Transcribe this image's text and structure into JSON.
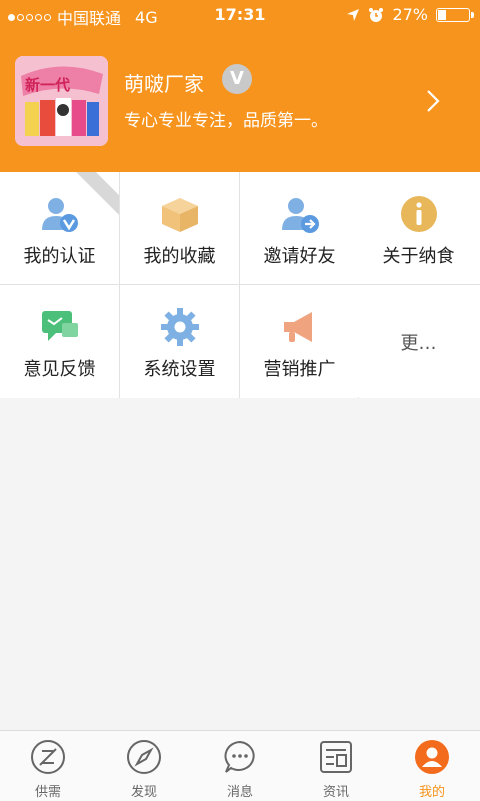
{
  "status_bar": {
    "carrier": "中国联通",
    "network": "4G",
    "time": "17:31",
    "battery": "27%",
    "battery_level": 0.27
  },
  "profile": {
    "name": "萌啵厂家",
    "verified_badge": "V",
    "slogan": "专心专业专注，品质第一。",
    "avatar_text": "新一代"
  },
  "menu": {
    "items": [
      {
        "label": "我的认证",
        "icon": "user-verify-icon",
        "ribbon": ""
      },
      {
        "label": "我的收藏",
        "icon": "box-icon"
      },
      {
        "label": "邀请好友",
        "icon": "invite-user-icon"
      },
      {
        "label": "关于纳食",
        "icon": "info-icon"
      },
      {
        "label": "意见反馈",
        "icon": "chat-feedback-icon"
      },
      {
        "label": "系统设置",
        "icon": "gear-icon"
      },
      {
        "label": "营销推广",
        "icon": "megaphone-icon"
      },
      {
        "label": "更…",
        "icon": ""
      }
    ]
  },
  "tabbar": {
    "tabs": [
      {
        "label": "供需",
        "icon": "supply-demand-icon"
      },
      {
        "label": "发现",
        "icon": "compass-icon"
      },
      {
        "label": "消息",
        "icon": "message-icon"
      },
      {
        "label": "资讯",
        "icon": "news-icon"
      },
      {
        "label": "我的",
        "icon": "profile-icon"
      }
    ],
    "active_index": 4
  },
  "colors": {
    "primary": "#f7941d",
    "verify_blue": "#7fb0e3",
    "box_tan": "#f0c27a",
    "info_gold": "#e7b75a",
    "chat_green": "#4cc07b",
    "gear_blue": "#7fb0e3",
    "megaphone_orange": "#f0a37f"
  }
}
